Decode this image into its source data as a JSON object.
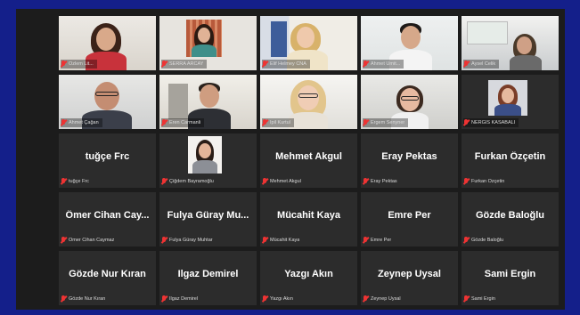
{
  "participants": [
    {
      "label": "Özlem Lit..."
    },
    {
      "label": "SERRA ARCAY"
    },
    {
      "label": "Elif Helmey CNA"
    },
    {
      "label": "Ahmet Ümit..."
    },
    {
      "label": "Aysel Celik"
    },
    {
      "label": "Ahmet Çağan"
    },
    {
      "label": "Eren Carmanli"
    },
    {
      "label": "İpil Kurtul"
    },
    {
      "label": "Ergem Senyner"
    },
    {
      "label": "NERGİS KASABALI"
    },
    {
      "name": "tuğçe Frc",
      "label": "tuğçe Frc"
    },
    {
      "label": "Çiğdem Bayramoğlu"
    },
    {
      "name": "Mehmet Akgul",
      "label": "Mehmet Akgul"
    },
    {
      "name": "Eray Pektas",
      "label": "Eray Pektas"
    },
    {
      "name": "Furkan Özçetin",
      "label": "Furkan Özçetin"
    },
    {
      "name": "Ömer Cihan Cay...",
      "label": "Ömer Cihan Caymaz"
    },
    {
      "name": "Fulya Güray Mu...",
      "label": "Fulya Güray Muhtar"
    },
    {
      "name": "Mücahit Kaya",
      "label": "Mücahit Kaya"
    },
    {
      "name": "Emre Per",
      "label": "Emre Per"
    },
    {
      "name": "Gözde Baloğlu",
      "label": "Gözde Baloğlu"
    },
    {
      "name": "Gözde Nur Kıran",
      "label": "Gözde Nur Kıran"
    },
    {
      "name": "Ilgaz Demirel",
      "label": "Ilgaz Demirel"
    },
    {
      "name": "Yazgı Akın",
      "label": "Yazgı Akın"
    },
    {
      "name": "Zeynep Uysal",
      "label": "Zeynep Uysal"
    },
    {
      "name": "Sami Ergin",
      "label": "Sami Ergin"
    }
  ],
  "icons": {
    "muted": "muted-mic-icon"
  },
  "colors": {
    "frame": "#141f8a",
    "tile": "#2c2c2c",
    "active_border": "#e8ea5a",
    "muted": "#e33333"
  }
}
